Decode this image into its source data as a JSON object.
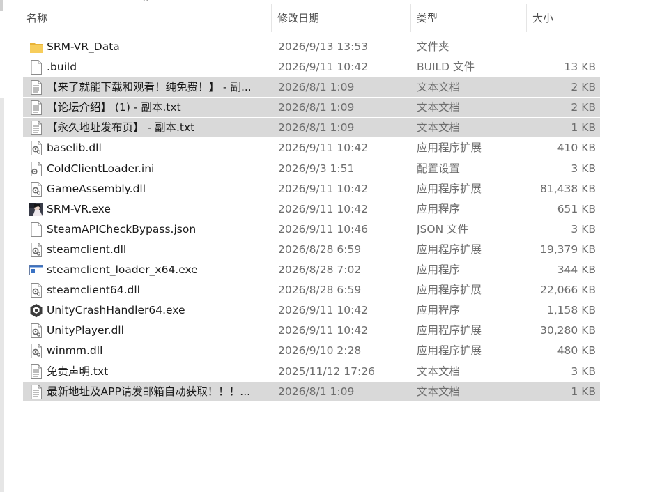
{
  "columns": {
    "name": "名称",
    "date": "修改日期",
    "type": "类型",
    "size": "大小",
    "sort_arrow": "^"
  },
  "files": [
    {
      "name": "SRM-VR_Data",
      "date": "2026/9/13 13:53",
      "type": "文件夹",
      "size": "",
      "icon": "folder-icon",
      "selected": false
    },
    {
      "name": ".build",
      "date": "2026/9/11 10:42",
      "type": "BUILD 文件",
      "size": "13 KB",
      "icon": "blank-file-icon",
      "selected": false
    },
    {
      "name": "【来了就能下载和观看！纯免费！】 - 副...",
      "date": "2026/8/1 1:09",
      "type": "文本文档",
      "size": "2 KB",
      "icon": "text-file-icon",
      "selected": true
    },
    {
      "name": "【论坛介绍】 (1) - 副本.txt",
      "date": "2026/8/1 1:09",
      "type": "文本文档",
      "size": "2 KB",
      "icon": "text-file-icon",
      "selected": true
    },
    {
      "name": "【永久地址发布页】  - 副本.txt",
      "date": "2026/8/1 1:09",
      "type": "文本文档",
      "size": "1 KB",
      "icon": "text-file-icon",
      "selected": true
    },
    {
      "name": "baselib.dll",
      "date": "2026/9/11 10:42",
      "type": "应用程序扩展",
      "size": "410 KB",
      "icon": "dll-file-icon",
      "selected": false
    },
    {
      "name": "ColdClientLoader.ini",
      "date": "2026/9/3 1:51",
      "type": "配置设置",
      "size": "3 KB",
      "icon": "ini-file-icon",
      "selected": false
    },
    {
      "name": "GameAssembly.dll",
      "date": "2026/9/11 10:42",
      "type": "应用程序扩展",
      "size": "81,438 KB",
      "icon": "dll-file-icon",
      "selected": false
    },
    {
      "name": "SRM-VR.exe",
      "date": "2026/9/11 10:42",
      "type": "应用程序",
      "size": "651 KB",
      "icon": "game-exe-icon",
      "selected": false
    },
    {
      "name": "SteamAPICheckBypass.json",
      "date": "2026/9/11 10:46",
      "type": "JSON 文件",
      "size": "3 KB",
      "icon": "blank-file-icon",
      "selected": false
    },
    {
      "name": "steamclient.dll",
      "date": "2026/8/28 6:59",
      "type": "应用程序扩展",
      "size": "19,379 KB",
      "icon": "dll-file-icon",
      "selected": false
    },
    {
      "name": "steamclient_loader_x64.exe",
      "date": "2026/8/28 7:02",
      "type": "应用程序",
      "size": "344 KB",
      "icon": "exe-window-icon",
      "selected": false
    },
    {
      "name": "steamclient64.dll",
      "date": "2026/8/28 6:59",
      "type": "应用程序扩展",
      "size": "22,066 KB",
      "icon": "dll-file-icon",
      "selected": false
    },
    {
      "name": "UnityCrashHandler64.exe",
      "date": "2026/9/11 10:42",
      "type": "应用程序",
      "size": "1,158 KB",
      "icon": "unity-icon",
      "selected": false
    },
    {
      "name": "UnityPlayer.dll",
      "date": "2026/9/11 10:42",
      "type": "应用程序扩展",
      "size": "30,280 KB",
      "icon": "dll-file-icon",
      "selected": false
    },
    {
      "name": "winmm.dll",
      "date": "2026/9/10 2:28",
      "type": "应用程序扩展",
      "size": "480 KB",
      "icon": "dll-file-icon",
      "selected": false
    },
    {
      "name": "免责声明.txt",
      "date": "2025/11/12 17:26",
      "type": "文本文档",
      "size": "3 KB",
      "icon": "text-file-icon",
      "selected": false
    },
    {
      "name": "最新地址及APP请发邮箱自动获取！！！...",
      "date": "2026/8/1 1:09",
      "type": "文本文档",
      "size": "1 KB",
      "icon": "text-file-icon",
      "selected": true
    }
  ],
  "colors": {
    "selected_row": "#d9d9d9",
    "folder": "#f2c14e",
    "header_text": "#4d4d4d",
    "meta_text": "#6d6d6d"
  }
}
